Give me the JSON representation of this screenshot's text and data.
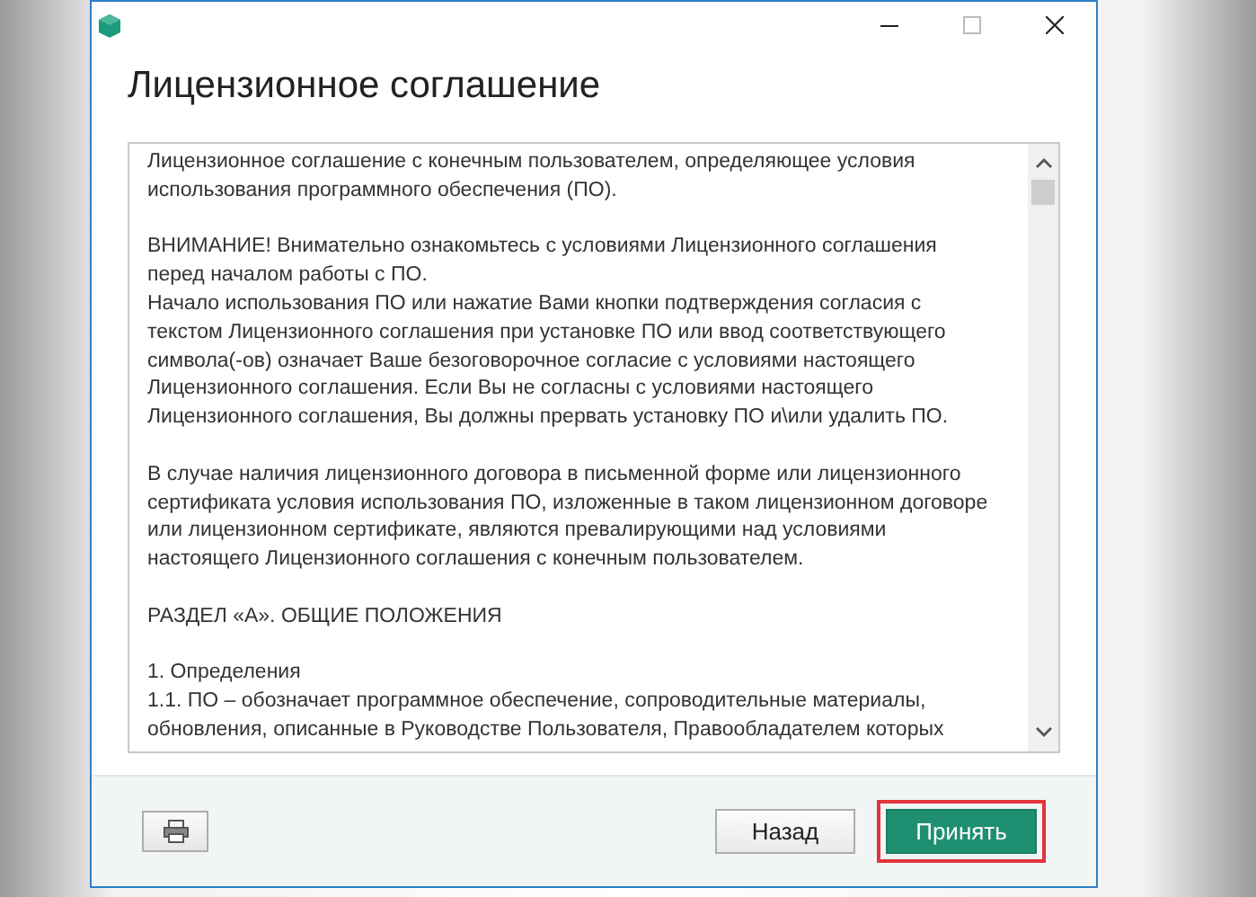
{
  "window": {
    "title": "Лицензионное соглашение"
  },
  "agreement": {
    "paragraphs": [
      {
        "lines": [
          "Лицензионное соглашение с конечным пользователем, определяющее условия",
          "использования программного обеспечения (ПО)."
        ]
      },
      {
        "lines": [
          "ВНИМАНИЕ! Внимательно ознакомьтесь с условиями Лицензионного соглашения",
          "перед началом работы с ПО.",
          "Начало использования ПО или нажатие Вами кнопки подтверждения согласия с",
          "текстом Лицензионного соглашения при установке ПО или ввод соответствующего",
          "символа(-ов) означает Ваше безоговорочное согласие с условиями настоящего",
          "Лицензионного соглашения. Если Вы не согласны с условиями настоящего",
          "Лицензионного соглашения, Вы должны прервать установку ПО и\\или удалить ПО."
        ]
      },
      {
        "lines": [
          "В случае наличия лицензионного договора в письменной форме или лицензионного",
          "сертификата условия использования ПО, изложенные в таком лицензионном договоре",
          "или лицензионном сертификате, являются превалирующими над условиями",
          "настоящего Лицензионного соглашения с конечным пользователем."
        ]
      },
      {
        "lines": [
          "РАЗДЕЛ «А». ОБЩИЕ ПОЛОЖЕНИЯ"
        ]
      },
      {
        "lines": [
          "1. Определения",
          "1.1. ПО – обозначает программное обеспечение, сопроводительные материалы,",
          "обновления, описанные в Руководстве Пользователя, Правообладателем которых"
        ]
      }
    ]
  },
  "buttons": [
    {
      "label": "Назад",
      "kind": "secondary",
      "highlighted": false
    },
    {
      "label": "Принять",
      "kind": "primary",
      "highlighted": true
    }
  ]
}
